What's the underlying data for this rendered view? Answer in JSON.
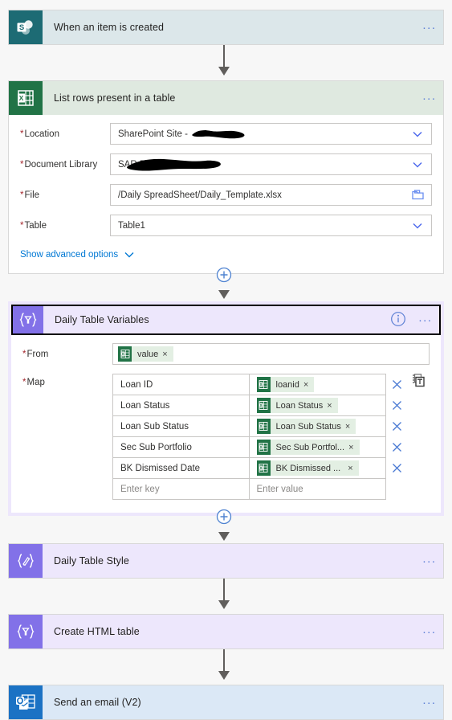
{
  "flow": {
    "steps": [
      {
        "id": "trigger-sharepoint",
        "title": "When an item is created",
        "connector": "sharepoint",
        "icon": "sharepoint-icon",
        "theme": "sp",
        "selected": false,
        "expanded": false,
        "menu_label": "..."
      },
      {
        "id": "list-rows-excel",
        "title": "List rows present in a table",
        "connector": "excel",
        "icon": "excel-icon",
        "theme": "xl",
        "selected": false,
        "expanded": true,
        "menu_label": "...",
        "fields": [
          {
            "label": "Location",
            "required": true,
            "value": "SharePoint Site - ",
            "redacted": true,
            "control": "dropdown",
            "name": "location-field"
          },
          {
            "label": "Document Library",
            "required": true,
            "value": "SAR D",
            "redacted": true,
            "control": "dropdown",
            "name": "document-library-field"
          },
          {
            "label": "File",
            "required": true,
            "value": "/Daily SpreadSheet/Daily_Template.xlsx",
            "redacted": false,
            "control": "filepicker",
            "name": "file-field"
          },
          {
            "label": "Table",
            "required": true,
            "value": "Table1",
            "redacted": false,
            "control": "dropdown",
            "name": "table-field"
          }
        ],
        "advanced_label": "Show advanced options"
      },
      {
        "id": "daily-table-variables",
        "title": "Daily Table Variables",
        "connector": "variables",
        "icon": "braces-filter-icon",
        "theme": "pu",
        "selected": true,
        "expanded": true,
        "menu_label": "...",
        "info_label": "i",
        "from": {
          "label": "From",
          "required": true,
          "token": {
            "text": "value",
            "icon": "excel-token-icon",
            "remove_label": "×"
          }
        },
        "map": {
          "label": "Map",
          "required": true,
          "rows": [
            {
              "key": "Loan ID",
              "token": "loanid",
              "remove_label": "×"
            },
            {
              "key": "Loan Status",
              "token": "Loan Status",
              "remove_label": "×"
            },
            {
              "key": "Loan Sub Status",
              "token": "Loan Sub Status",
              "remove_label": "×"
            },
            {
              "key": "Sec Sub Portfolio",
              "token": "Sec Sub Portfol...",
              "remove_label": "×"
            },
            {
              "key": "BK Dismissed Date",
              "token": "BK Dismissed ...",
              "remove_label": "×"
            }
          ],
          "new_key_placeholder": "Enter key",
          "new_value_placeholder": "Enter value"
        }
      },
      {
        "id": "daily-table-style",
        "title": "Daily Table Style",
        "connector": "variables",
        "icon": "braces-pencil-icon",
        "theme": "pu",
        "selected": false,
        "expanded": false,
        "menu_label": "..."
      },
      {
        "id": "create-html-table",
        "title": "Create HTML table",
        "connector": "data-operations",
        "icon": "braces-filter-icon",
        "theme": "pu",
        "selected": false,
        "expanded": false,
        "menu_label": "..."
      },
      {
        "id": "send-an-email",
        "title": "Send an email (V2)",
        "connector": "outlook",
        "icon": "outlook-icon",
        "theme": "ol",
        "selected": false,
        "expanded": false,
        "menu_label": "..."
      }
    ],
    "add_step_label": "+",
    "colors": {
      "sharepoint_icon": "#1d6b74",
      "sharepoint_card": "#dce7ea",
      "excel_icon": "#217346",
      "excel_card": "#dfe9e0",
      "variables_icon": "#8271e8",
      "variables_card": "#ede7fc",
      "outlook_icon": "#1b72c4",
      "outlook_card": "#dbe8f6",
      "accent_link": "#0078d4",
      "required_star": "#a4262c",
      "connector_arrow": "#605e5c",
      "token_pill": "#e3efe3",
      "canvas": "#f7f7f7"
    }
  }
}
